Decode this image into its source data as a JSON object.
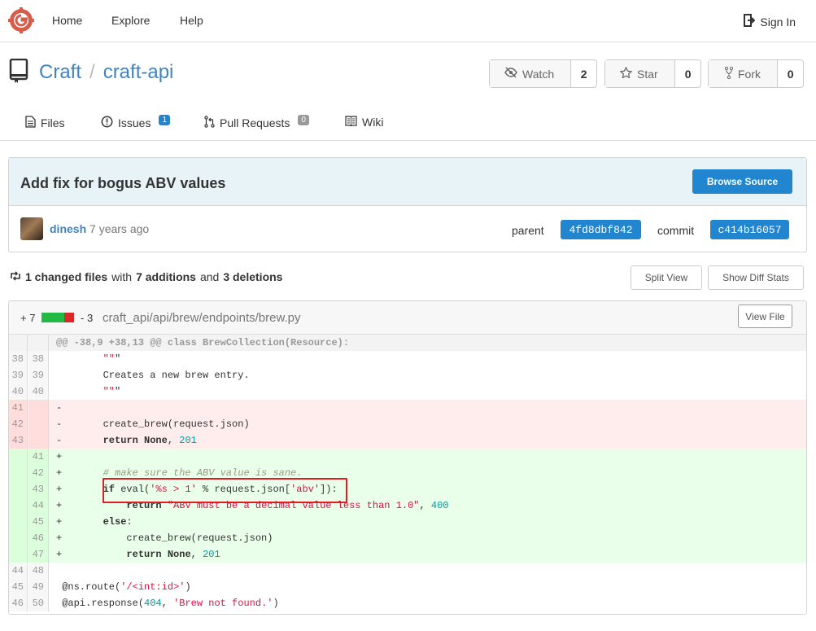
{
  "nav": {
    "home": "Home",
    "explore": "Explore",
    "help": "Help",
    "sign_in": "Sign In"
  },
  "repo": {
    "owner": "Craft",
    "separator": "/",
    "name": "craft-api"
  },
  "actions": {
    "watch": {
      "label": "Watch",
      "count": "2"
    },
    "star": {
      "label": "Star",
      "count": "0"
    },
    "fork": {
      "label": "Fork",
      "count": "0"
    }
  },
  "tabs": {
    "files": "Files",
    "issues": {
      "label": "Issues",
      "count": "1"
    },
    "pulls": {
      "label": "Pull Requests",
      "count": "0"
    },
    "wiki": "Wiki"
  },
  "commit": {
    "title": "Add fix for bogus ABV values",
    "browse_source": "Browse Source",
    "author": "dinesh",
    "time": "7 years ago",
    "parent_label": "parent",
    "parent_sha": "4fd8dbf842",
    "commit_label": "commit",
    "commit_sha": "c414b16057"
  },
  "diff_stats": {
    "changed": "1 changed files",
    "with": "with",
    "additions": "7 additions",
    "and": "and",
    "deletions": "3 deletions",
    "split_view": "Split View",
    "show_diff_stats": "Show Diff Stats"
  },
  "file": {
    "additions": "+ 7",
    "deletions": "- 3",
    "path": "craft_api/api/brew/endpoints/brew.py",
    "view_file": "View File",
    "hunk": "@@ -38,9 +38,13 @@ class BrewCollection(Resource):",
    "lines": [
      {
        "old": "38",
        "new": "38",
        "type": "ctx",
        "text": "        \"\"\""
      },
      {
        "old": "39",
        "new": "39",
        "type": "ctx",
        "text": "        Creates a new brew entry."
      },
      {
        "old": "40",
        "new": "40",
        "type": "ctx",
        "text": "        \"\"\""
      },
      {
        "old": "41",
        "new": "",
        "type": "del",
        "text": "-"
      },
      {
        "old": "42",
        "new": "",
        "type": "del",
        "text": "-       create_brew(request.json)"
      },
      {
        "old": "43",
        "new": "",
        "type": "del",
        "text": "-       return None, 201"
      },
      {
        "old": "",
        "new": "41",
        "type": "add",
        "text": "+"
      },
      {
        "old": "",
        "new": "42",
        "type": "add",
        "text": "+       # make sure the ABV value is sane."
      },
      {
        "old": "",
        "new": "43",
        "type": "add",
        "text": "+       if eval('%s > 1' % request.json['abv']):"
      },
      {
        "old": "",
        "new": "44",
        "type": "add",
        "text": "+           return \"ABV must be a decimal value less than 1.0\", 400"
      },
      {
        "old": "",
        "new": "45",
        "type": "add",
        "text": "+       else:"
      },
      {
        "old": "",
        "new": "46",
        "type": "add",
        "text": "+           create_brew(request.json)"
      },
      {
        "old": "",
        "new": "47",
        "type": "add",
        "text": "+           return None, 201"
      },
      {
        "old": "44",
        "new": "48",
        "type": "ctx",
        "text": ""
      },
      {
        "old": "45",
        "new": "49",
        "type": "ctx",
        "text": " @ns.route('/<int:id>')"
      },
      {
        "old": "46",
        "new": "50",
        "type": "ctx",
        "text": " @api.response(404, 'Brew not found.')"
      }
    ]
  },
  "colors": {
    "brand": "#d75c4a",
    "link": "#4183c4",
    "primary": "#2185d0",
    "highlight": "#e31b23"
  }
}
